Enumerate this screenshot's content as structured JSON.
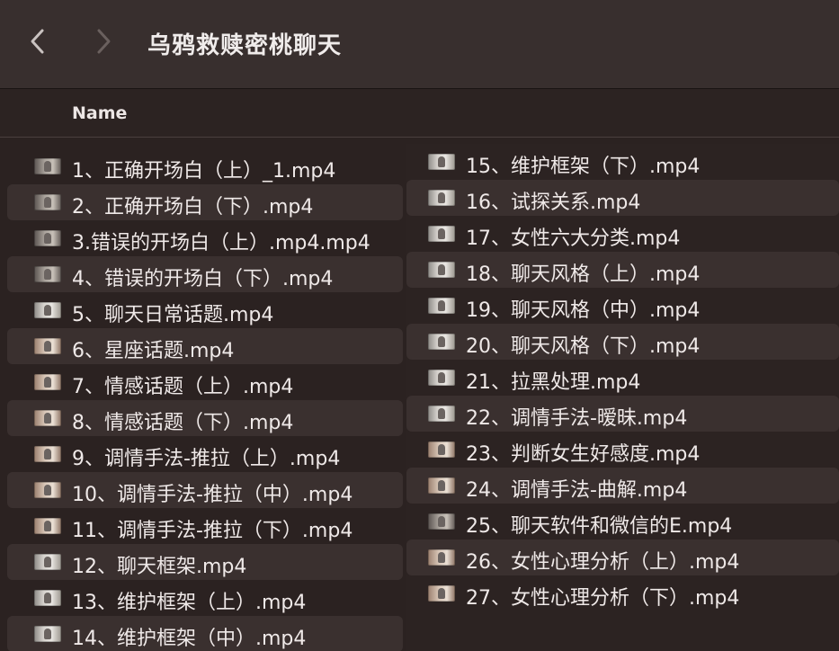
{
  "window": {
    "title": "乌鸦救赎密桃聊天"
  },
  "toolbar": {
    "back_icon": "chevron-left-icon",
    "forward_icon": "chevron-right-icon"
  },
  "list_header": {
    "name_label": "Name"
  },
  "files_left": [
    {
      "name": "1、正确开场白（上）_1.mp4"
    },
    {
      "name": "2、正确开场白（下）.mp4"
    },
    {
      "name": "3.错误的开场白（上）.mp4.mp4"
    },
    {
      "name": "4、错误的开场白（下）.mp4"
    },
    {
      "name": "5、聊天日常话题.mp4"
    },
    {
      "name": "6、星座话题.mp4"
    },
    {
      "name": "7、情感话题（上）.mp4"
    },
    {
      "name": "8、情感话题（下）.mp4"
    },
    {
      "name": "9、调情手法-推拉（上）.mp4"
    },
    {
      "name": "10、调情手法-推拉（中）.mp4"
    },
    {
      "name": "11、调情手法-推拉（下）.mp4"
    },
    {
      "name": "12、聊天框架.mp4"
    },
    {
      "name": "13、维护框架（上）.mp4"
    },
    {
      "name": "14、维护框架（中）.mp4"
    }
  ],
  "files_right": [
    {
      "name": "15、维护框架（下）.mp4"
    },
    {
      "name": "16、试探关系.mp4"
    },
    {
      "name": "17、女性六大分类.mp4"
    },
    {
      "name": "18、聊天风格（上）.mp4"
    },
    {
      "name": "19、聊天风格（中）.mp4"
    },
    {
      "name": "20、聊天风格（下）.mp4"
    },
    {
      "name": "21、拉黑处理.mp4"
    },
    {
      "name": "22、调情手法-暧昧.mp4"
    },
    {
      "name": "23、判断女生好感度.mp4"
    },
    {
      "name": "24、调情手法-曲解.mp4"
    },
    {
      "name": "25、聊天软件和微信的E.mp4"
    },
    {
      "name": "26、女性心理分析（上）.mp4"
    },
    {
      "name": "27、女性心理分析（下）.mp4"
    }
  ],
  "colors": {
    "toolbar_bg": "#382f2e",
    "list_bg": "#2b2221",
    "alt_row_bg": "#3a302f",
    "text": "#efe9e8"
  }
}
